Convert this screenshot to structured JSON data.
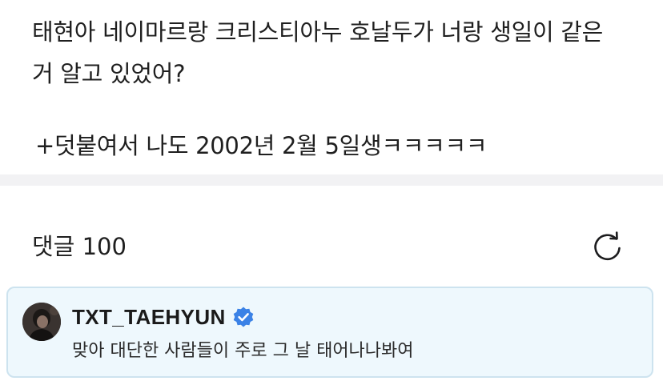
{
  "post": {
    "lines": [
      "태현아 네이마르랑 크리스티아누 호날두가 너랑 생일이 같은",
      "거 알고 있었어?"
    ],
    "addendum": "+덧붙여서 나도 2002년 2월 5일생ㅋㅋㅋㅋㅋ"
  },
  "comments": {
    "header_label": "댓글 100",
    "refresh_icon": "refresh-icon",
    "items": [
      {
        "author": "TXT_TAEHYUN",
        "verified": true,
        "verified_icon": "verified-badge-icon",
        "verified_color": "#3b82e6",
        "text": "맞아 대단한 사람들이 주로 그 날 태어나나봐여"
      }
    ]
  },
  "colors": {
    "card_background": "#eef8fd",
    "card_border": "#cde3ef",
    "divider": "#f2f2f4"
  }
}
